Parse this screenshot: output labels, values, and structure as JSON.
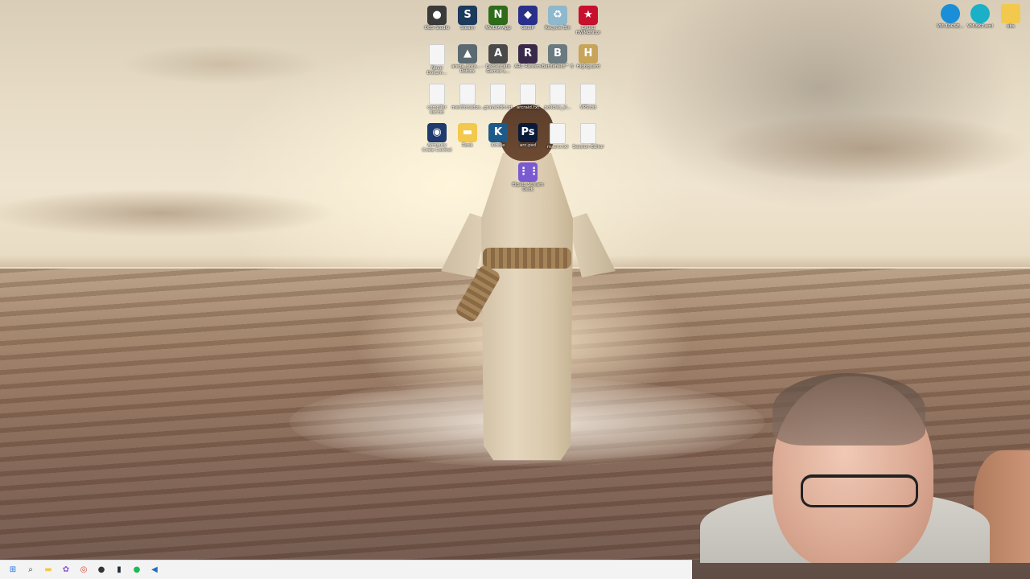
{
  "desktop": {
    "center_icons": [
      {
        "label": "OBS Studio",
        "icon": "obs-icon",
        "color": "#3a3a3a",
        "glyph": "●"
      },
      {
        "label": "Steam",
        "icon": "steam-icon",
        "color": "#1b3a5c",
        "glyph": "S"
      },
      {
        "label": "NVIDIA App",
        "icon": "nvidia-icon",
        "color": "#2e6b1a",
        "glyph": "N"
      },
      {
        "label": "GeoIP",
        "icon": "geo-icon",
        "color": "#2a2f8a",
        "glyph": "◆"
      },
      {
        "label": "Recycle Bin",
        "icon": "recycle-bin-icon",
        "color": "#8fb8cc",
        "glyph": "♻"
      },
      {
        "label": "CPUID HWMonitor",
        "icon": "hwmonitor-icon",
        "color": "#c8102e",
        "glyph": "★"
      },
      {
        "label": "Novo Dokum...",
        "icon": "document-icon",
        "color": "#f5f5f5",
        "glyph": ""
      },
      {
        "label": "arena_brea... - Roblox",
        "icon": "roblox-icon",
        "color": "#5a6a70",
        "glyph": "▲"
      },
      {
        "label": "Battlestate Games L...",
        "icon": "battlestate-icon",
        "color": "#4a4a4a",
        "glyph": "A"
      },
      {
        "label": "ARC Raiders",
        "icon": "arc-raiders-icon",
        "color": "#3a2a4a",
        "glyph": "R"
      },
      {
        "label": "Battlefield™ 6",
        "icon": "battlefield-icon",
        "color": "#6a7a80",
        "glyph": "B"
      },
      {
        "label": "Highguard",
        "icon": "highguard-icon",
        "color": "#c8a45a",
        "glyph": "H"
      },
      {
        "label": "compiler list.txt",
        "icon": "text-file-icon",
        "color": "#f5f5f5",
        "glyph": ""
      },
      {
        "label": "mentionados...",
        "icon": "text-file-icon",
        "color": "#f5f5f5",
        "glyph": ""
      },
      {
        "label": "gravando.txt",
        "icon": "text-file-icon",
        "color": "#f5f5f5",
        "glyph": ""
      },
      {
        "label": "arcraid.txt",
        "icon": "text-file-icon",
        "color": "#f5f5f5",
        "glyph": ""
      },
      {
        "label": "policias_sl...",
        "icon": "text-file-icon",
        "color": "#f5f5f5",
        "glyph": ""
      },
      {
        "label": "VPS.txt",
        "icon": "text-file-icon",
        "color": "#f5f5f5",
        "glyph": ""
      },
      {
        "label": "Armoury Crate Control",
        "icon": "armoury-icon",
        "color": "#1e3a6e",
        "glyph": "◉"
      },
      {
        "label": "Rock",
        "icon": "folder-icon",
        "color": "#f2c94c",
        "glyph": "▬"
      },
      {
        "label": "Kindle",
        "icon": "kindle-icon",
        "color": "#1d5a8a",
        "glyph": "K"
      },
      {
        "label": "arc.psd",
        "icon": "photoshop-icon",
        "color": "#0a1a3a",
        "glyph": "Ps"
      },
      {
        "label": "macro.txt",
        "icon": "text-file-icon",
        "color": "#f5f5f5",
        "glyph": ""
      },
      {
        "label": "Session Editor",
        "icon": "text-file-icon",
        "color": "#f5f5f5",
        "glyph": ""
      },
      {
        "label": "Elgato Stream Deck",
        "icon": "stream-deck-icon",
        "color": "#7a5ad0",
        "glyph": "⋮⋮"
      }
    ],
    "right_icons": [
      {
        "label": "VM-10CSE...",
        "icon": "edge-icon",
        "color": "#1a8fd8"
      },
      {
        "label": "VM-BKP.xml",
        "icon": "edge-icon",
        "color": "#1ab0c8"
      },
      {
        "label": "obs",
        "icon": "folder-icon",
        "color": "#f2c94c"
      }
    ]
  },
  "taskbar": {
    "items": [
      {
        "icon": "windows-start-icon",
        "glyph": "⊞",
        "color": "#1a73e8"
      },
      {
        "icon": "search-icon",
        "glyph": "⌕",
        "color": "#333333"
      },
      {
        "icon": "file-explorer-icon",
        "glyph": "▬",
        "color": "#f2c94c"
      },
      {
        "icon": "copilot-icon",
        "glyph": "✿",
        "color": "#8a5ad0"
      },
      {
        "icon": "chrome-icon",
        "glyph": "◎",
        "color": "#db4437"
      },
      {
        "icon": "obs-icon",
        "glyph": "●",
        "color": "#333333"
      },
      {
        "icon": "terminal-icon",
        "glyph": "▮",
        "color": "#222a3a"
      },
      {
        "icon": "spotify-icon",
        "glyph": "●",
        "color": "#1db954"
      },
      {
        "icon": "vscode-icon",
        "glyph": "◀",
        "color": "#1f6fc0"
      }
    ]
  }
}
